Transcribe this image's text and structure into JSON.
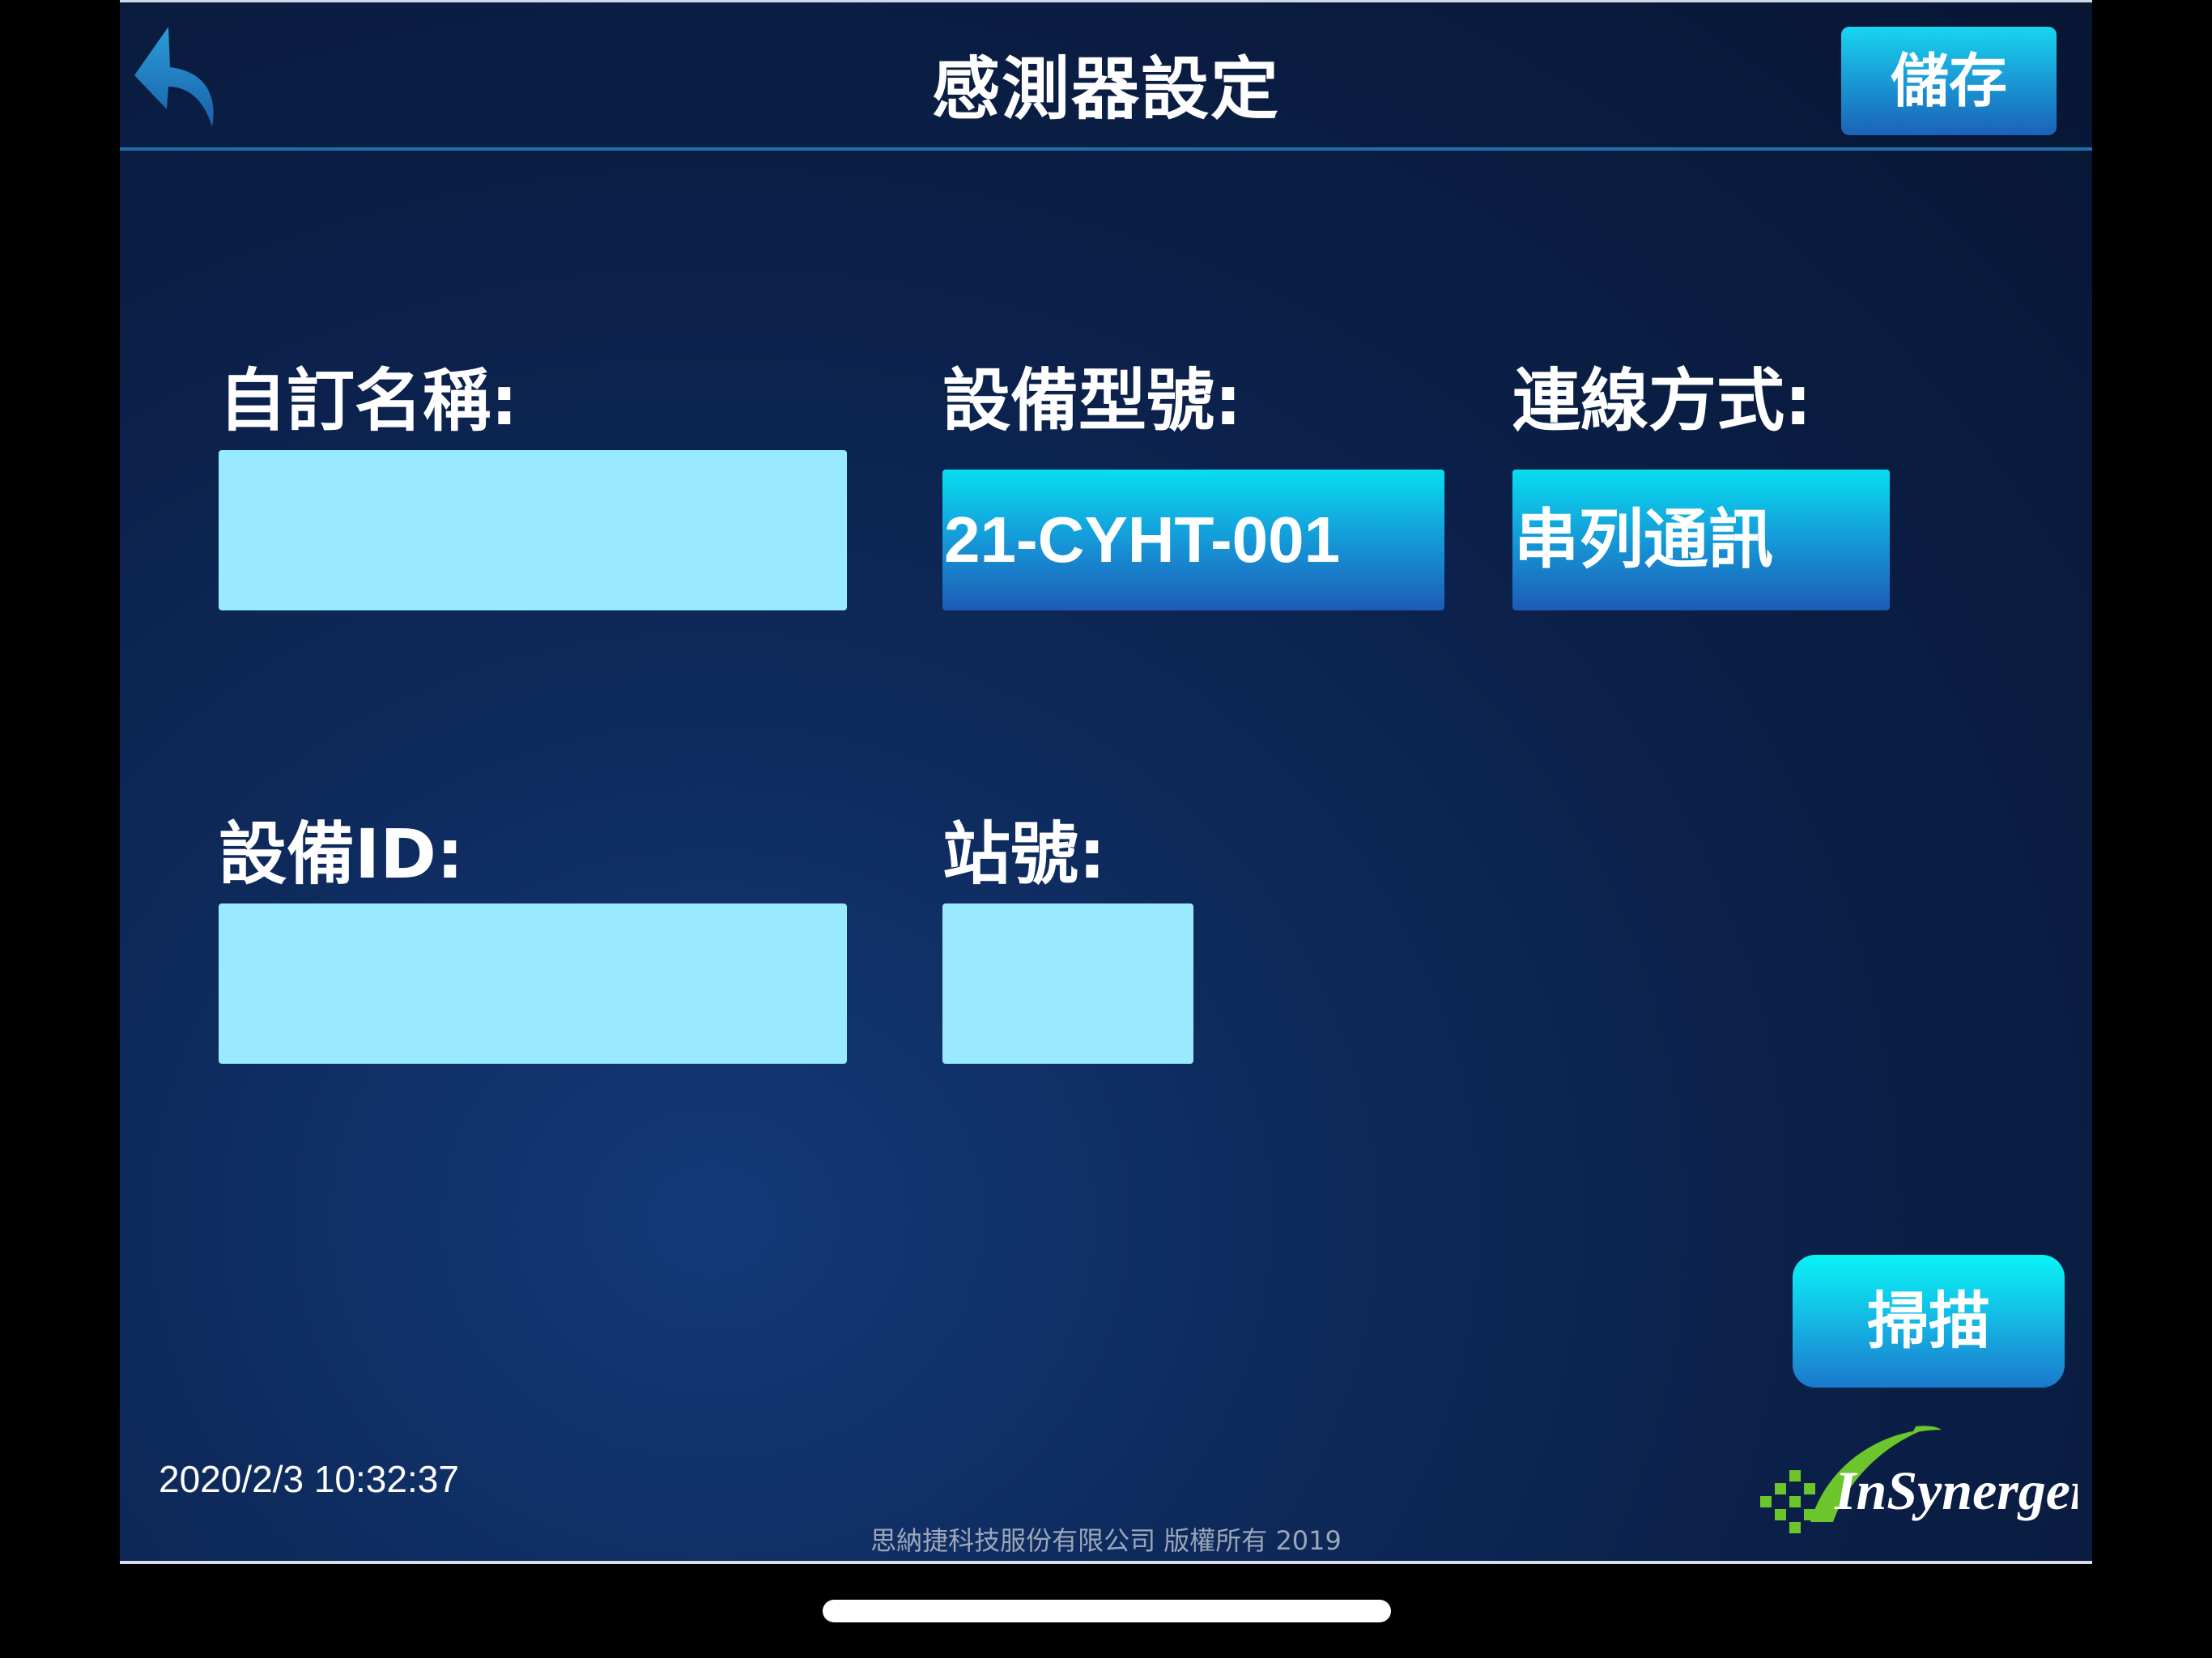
{
  "header": {
    "title": "感測器設定",
    "save_label": "儲存"
  },
  "form": {
    "custom_name": {
      "label": "自訂名稱:",
      "value": ""
    },
    "device_model": {
      "label": "設備型號:",
      "value": "21-CYHT-001"
    },
    "connection_method": {
      "label": "連線方式:",
      "value": "串列通訊"
    },
    "device_id": {
      "label": "設備ID:",
      "value": ""
    },
    "station_number": {
      "label": "站號:",
      "value": ""
    }
  },
  "scan_label": "掃描",
  "footer": {
    "timestamp": "2020/2/3 10:32:37",
    "copyright": "思納捷科技服份有限公司 版權所有 2019"
  },
  "logo": {
    "text": "InSynerger",
    "colors": {
      "green": "#6cc62b",
      "white": "#ffffff"
    }
  },
  "icons": {
    "back": "back-arrow-icon"
  },
  "colors": {
    "background": "#0b1f47",
    "input_fill": "#99eafe",
    "accent": "#17d6f0"
  }
}
